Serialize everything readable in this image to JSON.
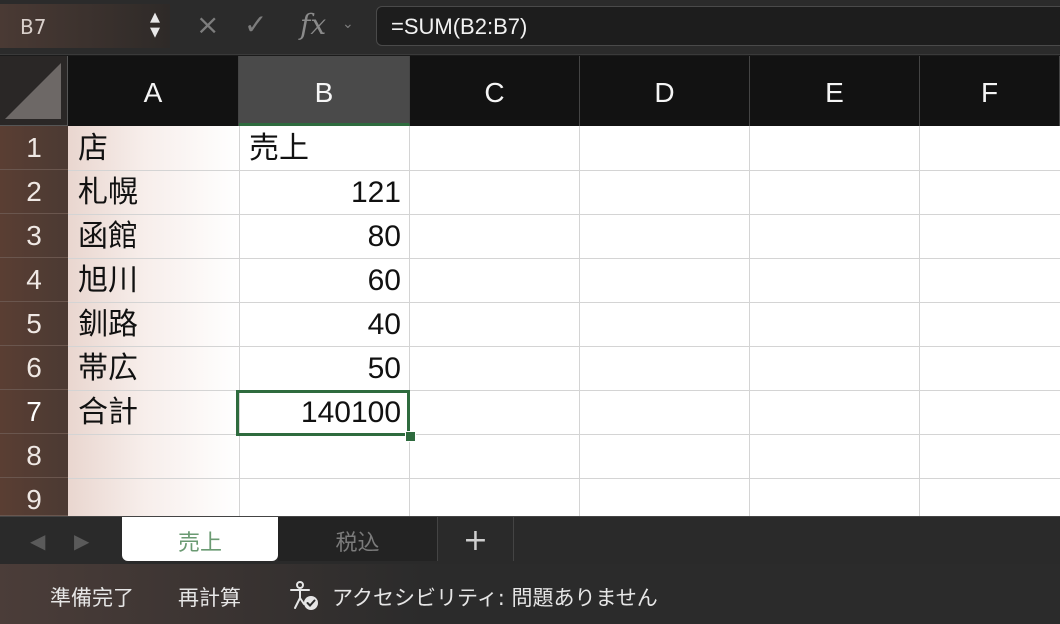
{
  "name_box": "B7",
  "formula": "=SUM(B2:B7)",
  "formula_icons": {
    "cancel": "×",
    "confirm": "✓",
    "fx": "fx"
  },
  "columns": [
    "A",
    "B",
    "C",
    "D",
    "E",
    "F"
  ],
  "rows": [
    "1",
    "2",
    "3",
    "4",
    "5",
    "6",
    "7",
    "8",
    "9"
  ],
  "cells": {
    "A1": "店",
    "B1": "売上",
    "A2": "札幌",
    "B2": "121",
    "A3": "函館",
    "B3": "80",
    "A4": "旭川",
    "B4": "60",
    "A5": "釧路",
    "B5": "40",
    "A6": "帯広",
    "B6": "50",
    "A7": "合計",
    "B7": "140100"
  },
  "sheets": [
    "売上",
    "税込"
  ],
  "add_sheet": "+",
  "status": {
    "ready": "準備完了",
    "recalc": "再計算",
    "accessibility": "アクセシビリティ: 問題ありません"
  }
}
